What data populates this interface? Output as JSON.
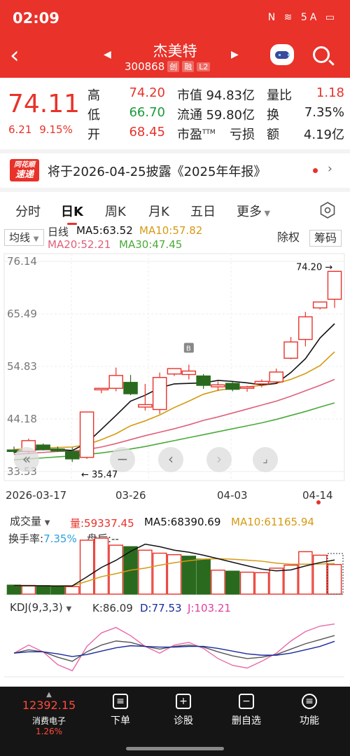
{
  "status_bar": {
    "time": "02:09",
    "icons": "N ≋ 5A ▭"
  },
  "header": {
    "name": "杰美特",
    "code": "300868",
    "tags": [
      "创",
      "融",
      "L2"
    ]
  },
  "quote": {
    "price": "74.11",
    "change": "6.21",
    "change_pct": "9.15%",
    "rows": [
      {
        "l1": "高",
        "v1": "74.20",
        "l2": "市值",
        "v2": "94.83亿",
        "l3": "量比",
        "v3": "1.18"
      },
      {
        "l1": "低",
        "v1": "66.70",
        "l2": "流通",
        "v2": "59.80亿",
        "l3": "换",
        "v3": "7.35%"
      },
      {
        "l1": "开",
        "v1": "68.45",
        "l2": "市盈",
        "v2": "亏损",
        "l3": "额",
        "v3": "4.19亿"
      }
    ],
    "pe_sup": "TTM"
  },
  "banner": {
    "logo_top": "同花顺",
    "logo_bottom": "速递",
    "text": "将于2026-04-25披露《2025年年报》"
  },
  "tabs": [
    "分时",
    "日K",
    "周K",
    "月K",
    "五日",
    "更多"
  ],
  "active_tab": 1,
  "kchart": {
    "indicator": "均线",
    "legend": {
      "title": "日线",
      "ma5": "MA5:63.52",
      "ma10": "MA10:57.82",
      "ma20": "MA20:52.21",
      "ma30": "MA30:47.45"
    },
    "buttons": {
      "adjust": "除权",
      "chips": "筹码"
    },
    "y_labels": [
      "76.14",
      "65.49",
      "54.83",
      "44.18",
      "33.53"
    ],
    "high_label": "74.20",
    "low_label": "35.47",
    "x_labels": [
      "2026-03-17",
      "03-26",
      "04-03",
      "04-14"
    ],
    "marker": "B"
  },
  "volume": {
    "selector": "成交量",
    "vol": "量:59337.45",
    "ma5": "MA5:68390.69",
    "ma10": "MA10:61165.94",
    "turnover_label": "换手率:",
    "turnover": "7.35%",
    "after": "盘后:--"
  },
  "kdj": {
    "selector": "KDJ(9,3,3)",
    "k": "K:86.09",
    "d": "D:77.53",
    "j": "J:103.21"
  },
  "bottom_nav": {
    "index_value": "12392.15",
    "index_name": "消费电子",
    "index_pct": "1.26%",
    "items": [
      "下单",
      "诊股",
      "删自选",
      "功能"
    ]
  },
  "colors": {
    "up": "#e8322a",
    "down": "#2a6a1e",
    "ma5": "#111111",
    "ma10": "#d59a12",
    "ma20": "#e0607a",
    "ma30": "#4aaa3a"
  },
  "chart_data": {
    "type": "candlestick",
    "y_range": [
      33.53,
      76.14
    ],
    "candles": [
      {
        "o": 37.9,
        "h": 38.6,
        "l": 37.2,
        "c": 37.6
      },
      {
        "o": 37.6,
        "h": 40.2,
        "l": 37.1,
        "c": 39.8
      },
      {
        "o": 38.9,
        "h": 39.2,
        "l": 37.8,
        "c": 38.0
      },
      {
        "o": 38.1,
        "h": 38.6,
        "l": 37.5,
        "c": 37.7
      },
      {
        "o": 37.6,
        "h": 38.4,
        "l": 35.47,
        "c": 36.1
      },
      {
        "o": 36.4,
        "h": 45.6,
        "l": 36.1,
        "c": 45.6
      },
      {
        "o": 50.1,
        "h": 50.4,
        "l": 49.4,
        "c": 50.4
      },
      {
        "o": 50.4,
        "h": 54.6,
        "l": 49.8,
        "c": 53.0
      },
      {
        "o": 51.6,
        "h": 53.1,
        "l": 49.0,
        "c": 49.3
      },
      {
        "o": 46.6,
        "h": 51.3,
        "l": 45.9,
        "c": 47.1
      },
      {
        "o": 46.1,
        "h": 53.6,
        "l": 45.2,
        "c": 52.6
      },
      {
        "o": 53.3,
        "h": 53.9,
        "l": 52.9,
        "c": 54.4
      },
      {
        "o": 53.2,
        "h": 55.2,
        "l": 52.2,
        "c": 53.9
      },
      {
        "o": 52.9,
        "h": 53.3,
        "l": 50.3,
        "c": 51.0
      },
      {
        "o": 50.7,
        "h": 51.8,
        "l": 49.9,
        "c": 51.1
      },
      {
        "o": 51.4,
        "h": 51.7,
        "l": 49.8,
        "c": 50.2
      },
      {
        "o": 50.4,
        "h": 50.9,
        "l": 49.7,
        "c": 50.7
      },
      {
        "o": 51.3,
        "h": 52.2,
        "l": 50.6,
        "c": 51.8
      },
      {
        "o": 51.7,
        "h": 54.4,
        "l": 51.5,
        "c": 53.7
      },
      {
        "o": 56.5,
        "h": 60.8,
        "l": 56.3,
        "c": 59.8
      },
      {
        "o": 60.3,
        "h": 65.9,
        "l": 58.9,
        "c": 64.9
      },
      {
        "o": 66.7,
        "h": 67.7,
        "l": 66.4,
        "c": 67.9
      },
      {
        "o": 68.45,
        "h": 74.2,
        "l": 66.7,
        "c": 74.11
      }
    ],
    "ma5": [
      37.4,
      37.9,
      38.0,
      38.0,
      37.8,
      39.3,
      42.1,
      44.9,
      47.8,
      49.0,
      50.5,
      51.3,
      51.4,
      51.5,
      52.0,
      51.8,
      51.5,
      51.1,
      51.4,
      53.6,
      56.4,
      60.6,
      63.5
    ],
    "ma10": [
      38.0,
      38.2,
      38.3,
      38.4,
      38.5,
      39.0,
      40.0,
      41.2,
      42.8,
      43.8,
      45.0,
      46.5,
      47.8,
      49.2,
      50.0,
      50.4,
      50.7,
      51.0,
      51.4,
      52.2,
      53.4,
      55.0,
      57.8
    ],
    "ma20": [
      37.0,
      37.2,
      37.4,
      37.6,
      37.7,
      38.0,
      38.5,
      39.2,
      40.0,
      40.8,
      41.5,
      42.2,
      43.0,
      43.9,
      44.6,
      45.4,
      46.2,
      47.0,
      47.8,
      48.8,
      49.9,
      51.0,
      52.2
    ],
    "ma30": [
      35.9,
      36.1,
      36.3,
      36.5,
      36.7,
      37.0,
      37.3,
      37.7,
      38.1,
      38.6,
      39.2,
      39.8,
      40.4,
      41.0,
      41.6,
      42.2,
      42.8,
      43.4,
      44.1,
      44.9,
      45.7,
      46.6,
      47.45
    ],
    "volume": [
      18000,
      17500,
      17000,
      15500,
      15000,
      108000,
      112000,
      98000,
      95000,
      88000,
      82000,
      79000,
      76000,
      70000,
      48000,
      46000,
      44000,
      43000,
      52000,
      58000,
      85000,
      78000,
      59337.45
    ],
    "volume_up": [
      false,
      true,
      false,
      false,
      true,
      true,
      true,
      true,
      false,
      true,
      true,
      true,
      false,
      false,
      true,
      false,
      true,
      true,
      true,
      true,
      true,
      true,
      true
    ],
    "volume_ma5": [
      17000,
      16800,
      16600,
      16300,
      16600,
      34600,
      53500,
      67700,
      85600,
      100000,
      95000,
      88000,
      84000,
      78000,
      71000,
      63800,
      56800,
      50200,
      46600,
      48600,
      56400,
      63200,
      68390.69
    ],
    "volume_ma10": [
      16500,
      16600,
      16600,
      16600,
      16600,
      25600,
      35000,
      41000,
      48000,
      52000,
      58000,
      63000,
      67000,
      70000,
      71000,
      70000,
      68000,
      66000,
      62000,
      60000,
      60000,
      60500,
      61165.94
    ],
    "kdj_k": [
      60,
      65,
      62,
      54,
      48,
      62,
      72,
      78,
      76,
      70,
      66,
      70,
      72,
      69,
      62,
      56,
      52,
      54,
      58,
      66,
      74,
      80,
      86.09
    ],
    "kdj_d": [
      60,
      62,
      62,
      59,
      55,
      58,
      63,
      68,
      71,
      70,
      69,
      69,
      70,
      70,
      67,
      63,
      59,
      57,
      57,
      60,
      65,
      70,
      77.53
    ],
    "kdj_j": [
      60,
      72,
      62,
      43,
      34,
      70,
      90,
      98,
      86,
      70,
      60,
      72,
      76,
      67,
      52,
      42,
      38,
      48,
      60,
      78,
      92,
      100,
      103.21
    ]
  }
}
